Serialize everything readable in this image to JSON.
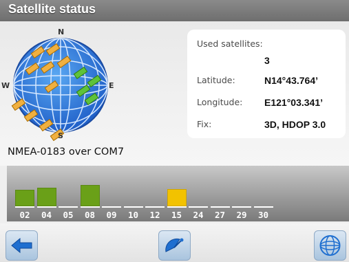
{
  "window": {
    "title": "Satellite status"
  },
  "compass": {
    "north": "N",
    "south": "S",
    "east": "E",
    "west": "W"
  },
  "info": {
    "used_label": "Used satellites:",
    "used_value": "3",
    "latitude_label": "Latitude:",
    "latitude_value": "N14°43.764’",
    "longitude_label": "Longitude:",
    "longitude_value": "E121°03.341’",
    "fix_label": "Fix:",
    "fix_value": "3D, HDOP 3.0"
  },
  "source_text": "NMEA-0183 over COM7",
  "satellites": [
    {
      "id": "02",
      "signal": 0.6,
      "color": "#6aa018"
    },
    {
      "id": "04",
      "signal": 0.7,
      "color": "#6aa018"
    },
    {
      "id": "05",
      "signal": 0,
      "color": "#ffffff"
    },
    {
      "id": "08",
      "signal": 0.8,
      "color": "#6aa018"
    },
    {
      "id": "09",
      "signal": 0,
      "color": "#ffffff"
    },
    {
      "id": "10",
      "signal": 0,
      "color": "#ffffff"
    },
    {
      "id": "12",
      "signal": 0,
      "color": "#ffffff"
    },
    {
      "id": "15",
      "signal": 0.65,
      "color": "#f2c200"
    },
    {
      "id": "24",
      "signal": 0,
      "color": "#ffffff"
    },
    {
      "id": "27",
      "signal": 0,
      "color": "#ffffff"
    },
    {
      "id": "29",
      "signal": 0,
      "color": "#ffffff"
    },
    {
      "id": "30",
      "signal": 0,
      "color": "#ffffff"
    }
  ],
  "toolbar": {
    "back_icon": "back-arrow-icon",
    "dish_icon": "satellite-dish-icon",
    "globe_icon": "globe-icon"
  }
}
